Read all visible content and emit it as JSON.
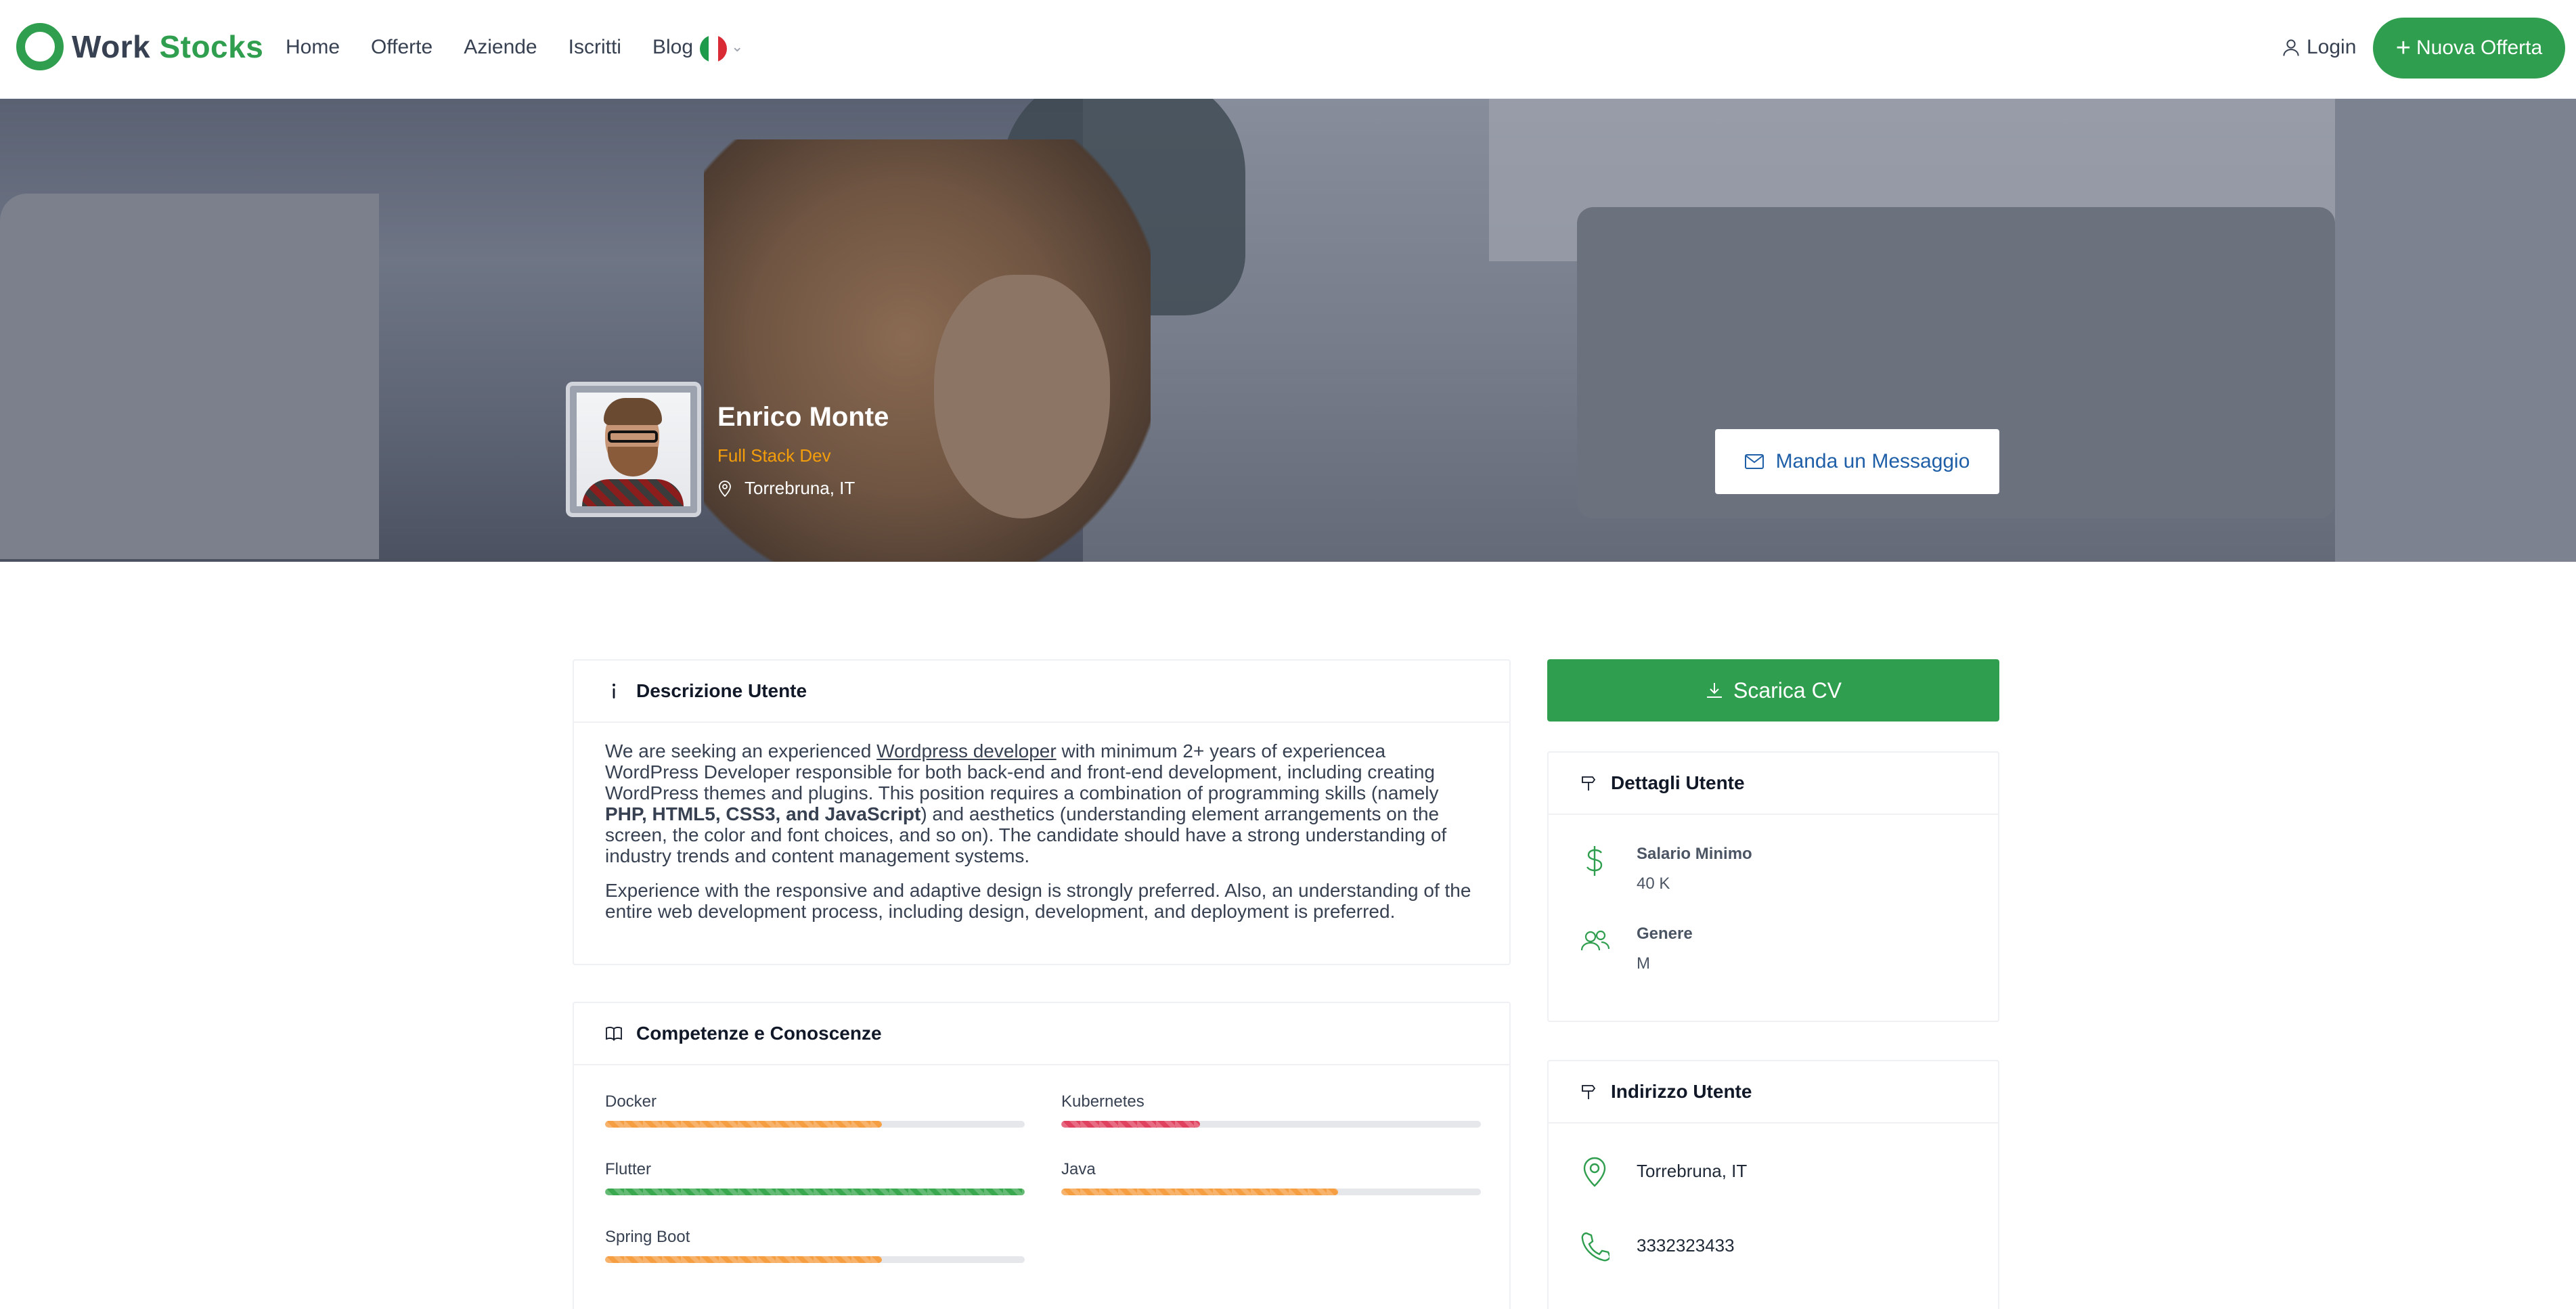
{
  "brand": {
    "part1": "Work",
    "part2": "Stocks"
  },
  "nav": {
    "items": [
      "Home",
      "Offerte",
      "Aziende",
      "Iscritti",
      "Blog"
    ]
  },
  "header": {
    "login": "Login",
    "new_offer": "Nuova Offerta",
    "lang_flag_colors": [
      "#1e9b4a",
      "#ffffff",
      "#d92b35"
    ]
  },
  "profile": {
    "name": "Enrico Monte",
    "role": "Full Stack Dev",
    "location": "Torrebruna, IT",
    "message_button": "Manda un Messaggio"
  },
  "description": {
    "title": "Descrizione Utente",
    "p1_a": "We are seeking an experienced ",
    "p1_link": "Wordpress developer",
    "p1_b": " with minimum 2+ years of experiencea WordPress Developer responsible for both back-end and front-end development, including creating WordPress themes and plugins. This position requires a combination of programming skills (namely ",
    "p1_bold": "PHP, HTML5, CSS3, and JavaScript",
    "p1_c": ") and aesthetics (understanding element arrangements on the screen, the color and font choices, and so on). The candidate should have a strong understanding of industry trends and content management systems.",
    "p2": "Experience with the responsive and adaptive design is strongly preferred. Also, an understanding of the entire web development process, including design, development, and deployment is preferred."
  },
  "skills": {
    "title": "Competenze e Conoscenze",
    "items": [
      {
        "name": "Docker",
        "level": 0.66,
        "color": "#f59e42"
      },
      {
        "name": "Kubernetes",
        "level": 0.33,
        "color": "#e0415f"
      },
      {
        "name": "Flutter",
        "level": 1.0,
        "color": "#3aa84e"
      },
      {
        "name": "Java",
        "level": 0.66,
        "color": "#f59e42"
      },
      {
        "name": "Spring Boot",
        "level": 0.66,
        "color": "#f59e42"
      }
    ]
  },
  "cv_button": "Scarica CV",
  "details": {
    "title": "Dettagli Utente",
    "salary_label": "Salario Minimo",
    "salary_value": "40 K",
    "gender_label": "Genere",
    "gender_value": "M"
  },
  "address": {
    "title": "Indirizzo Utente",
    "location": "Torrebruna, IT",
    "phone": "3332323433"
  }
}
